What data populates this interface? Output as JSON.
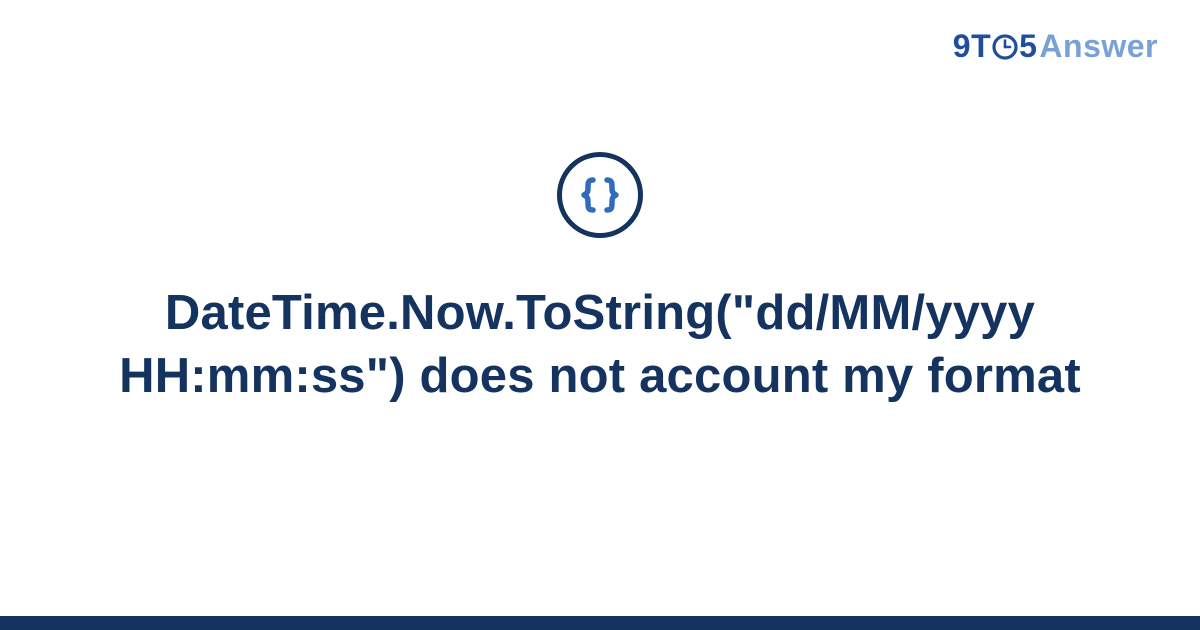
{
  "brand": {
    "part1": "9T",
    "part2": "5",
    "part3": "Answer"
  },
  "icon_name": "code-braces-icon",
  "title": "DateTime.Now.ToString(\"dd/MM/yyyy HH:mm:ss\") does not account my format",
  "colors": {
    "primary": "#14335f",
    "accent": "#1f4e9c",
    "light": "#7aa0d8"
  }
}
